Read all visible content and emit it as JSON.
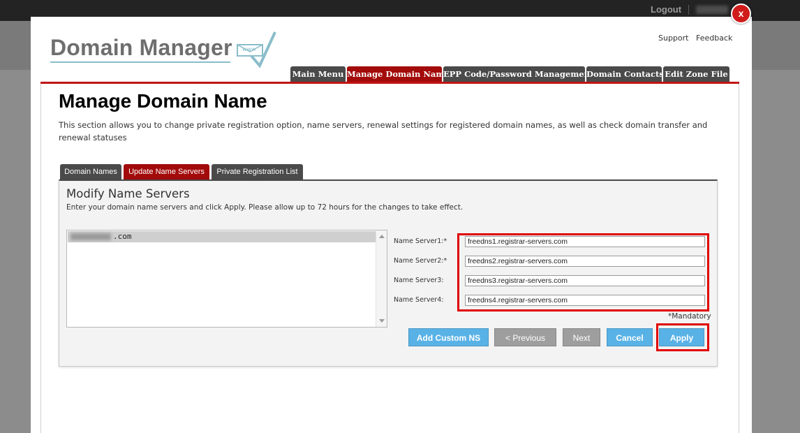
{
  "topbar": {
    "logout_label": "Logout"
  },
  "modal": {
    "close_label": "x"
  },
  "brand": {
    "logo_text": "Domain Manager",
    "logo_icon_text": "www"
  },
  "header_links": {
    "support": "Support",
    "feedback": "Feedback"
  },
  "main_tabs": [
    {
      "label": "Main Menu",
      "active": false
    },
    {
      "label": "Manage Domain Name",
      "active": true
    },
    {
      "label": "EPP Code/Password Management",
      "active": false
    },
    {
      "label": "Domain Contacts",
      "active": false
    },
    {
      "label": "Edit Zone File",
      "active": false
    }
  ],
  "page": {
    "title": "Manage Domain Name",
    "description": "This section allows you to change private registration option, name servers, renewal settings for registered domain names, as well as check domain transfer and renewal statuses"
  },
  "sub_tabs": [
    {
      "label": "Domain Names",
      "active": false
    },
    {
      "label": "Update Name Servers",
      "active": true
    },
    {
      "label": "Private Registration List",
      "active": false
    }
  ],
  "panel": {
    "title": "Modify Name Servers",
    "description": "Enter your domain name servers and click Apply. Please allow up to 72 hours for the changes to take effect."
  },
  "domain_list": {
    "selected_suffix": ".com"
  },
  "name_servers": [
    {
      "label": "Name Server1:*",
      "value": "freedns1.registrar-servers.com"
    },
    {
      "label": "Name Server2:*",
      "value": "freedns2.registrar-servers.com"
    },
    {
      "label": "Name Server3:",
      "value": "freedns3.registrar-servers.com"
    },
    {
      "label": "Name Server4:",
      "value": "freedns4.registrar-servers.com"
    }
  ],
  "mandatory_note": "*Mandatory",
  "buttons": {
    "add_custom_ns": "Add Custom NS",
    "previous": "< Previous",
    "next": "Next",
    "cancel": "Cancel",
    "apply": "Apply"
  },
  "colors": {
    "active_tab": "#a30b0b",
    "inactive_tab": "#4a4a4a",
    "primary_button": "#59b2e6",
    "disabled_button": "#9e9e9e",
    "highlight": "#e00000"
  }
}
